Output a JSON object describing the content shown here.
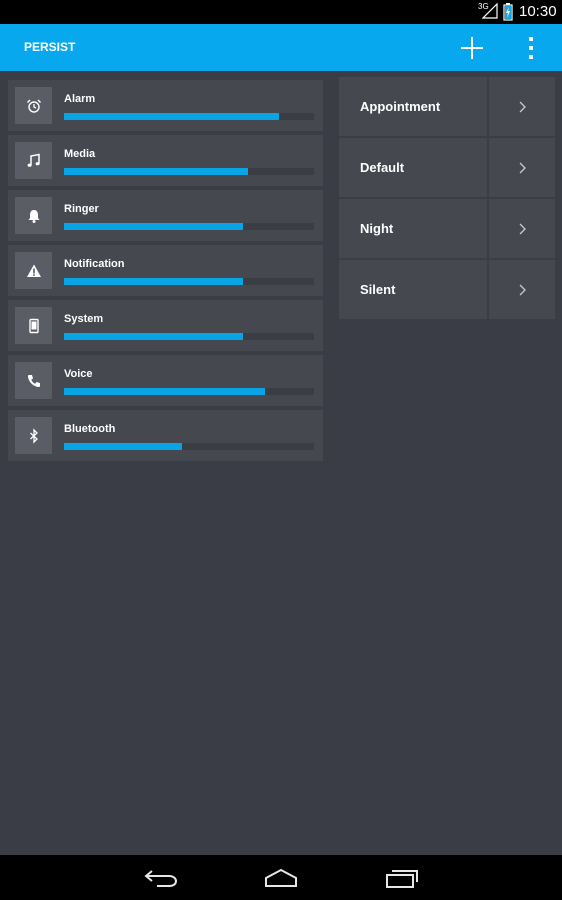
{
  "status_bar": {
    "network": "3G",
    "time": "10:30"
  },
  "app_bar": {
    "title": "PERSIST",
    "actions": [
      "plus-icon",
      "overflow-menu-icon"
    ]
  },
  "streams": [
    {
      "label": "Alarm",
      "icon": "alarm-icon",
      "level": 0.86
    },
    {
      "label": "Media",
      "icon": "music-note-icon",
      "level": 0.735
    },
    {
      "label": "Ringer",
      "icon": "bell-icon",
      "level": 0.715
    },
    {
      "label": "Notification",
      "icon": "warning-icon",
      "level": 0.715
    },
    {
      "label": "System",
      "icon": "phone-device-icon",
      "level": 0.715
    },
    {
      "label": "Voice",
      "icon": "phone-handset-icon",
      "level": 0.805
    },
    {
      "label": "Bluetooth",
      "icon": "bluetooth-icon",
      "level": 0.47
    }
  ],
  "profiles": [
    {
      "label": "Appointment"
    },
    {
      "label": "Default"
    },
    {
      "label": "Night"
    },
    {
      "label": "Silent"
    }
  ],
  "colors": {
    "accent": "#08a8ee",
    "background": "#3a3d46",
    "card": "#45484f",
    "icon_box": "#5a5d66",
    "track": "#3a3d44"
  },
  "nav_bar": [
    "back-icon",
    "home-icon",
    "recent-apps-icon"
  ]
}
